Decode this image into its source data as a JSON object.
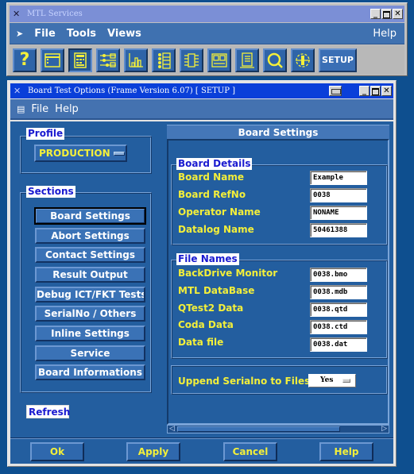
{
  "back_window": {
    "title": "MTL Services",
    "menu": [
      "File",
      "Tools",
      "Views"
    ],
    "help": "Help",
    "toolbar": [
      {
        "icon": "help-question-icon"
      },
      {
        "icon": "window-panel-icon"
      },
      {
        "icon": "calculator-grid-icon",
        "pressed": true
      },
      {
        "icon": "circuit-schematic-icon"
      },
      {
        "icon": "bar-chart-icon"
      },
      {
        "icon": "list-bullets-icon"
      },
      {
        "icon": "ic-chip-icon"
      },
      {
        "icon": "board-layout-icon"
      },
      {
        "icon": "document-list-icon"
      },
      {
        "icon": "magnifier-search-icon"
      },
      {
        "icon": "probe-tool-icon"
      }
    ],
    "setup_label": "SETUP"
  },
  "dialog": {
    "title": "Board Test Options (Frame Version 6.07)  [ SETUP ]",
    "menu_file": "File",
    "menu_help": "Help",
    "profile": {
      "label": "Profile",
      "value": "PRODUCTION"
    },
    "sections": {
      "label": "Sections",
      "items": [
        {
          "label": "Board Settings",
          "active": true
        },
        {
          "label": "Abort Settings"
        },
        {
          "label": "Contact Settings"
        },
        {
          "label": "Result Output"
        },
        {
          "label": "Debug ICT/FKT Tests"
        },
        {
          "label": "SerialNo / Others"
        },
        {
          "label": "Inline Settings"
        },
        {
          "label": "Service"
        },
        {
          "label": "Board Informations"
        }
      ]
    },
    "refresh_label": "Refresh",
    "board_settings": {
      "header": "Board Settings",
      "board_details": {
        "label": "Board Details",
        "fields": [
          {
            "label": "Board Name",
            "value": "Example"
          },
          {
            "label": "Board RefNo",
            "value": "0038"
          },
          {
            "label": "Operator Name",
            "value": "NONAME"
          },
          {
            "label": "Datalog Name",
            "value": "50461388"
          }
        ]
      },
      "file_names": {
        "label": "File Names",
        "fields": [
          {
            "label": "BackDrive Monitor",
            "value": "0038.bmo"
          },
          {
            "label": "MTL DataBase",
            "value": "0038.mdb"
          },
          {
            "label": "QTest2 Data",
            "value": "0038.qtd"
          },
          {
            "label": "Coda Data",
            "value": "0038.ctd"
          },
          {
            "label": "Data file",
            "value": "0038.dat"
          }
        ]
      },
      "uppend": {
        "label": "Uppend Serialno to Files",
        "value": "Yes"
      }
    },
    "buttons": {
      "ok": "Ok",
      "apply": "Apply",
      "cancel": "Cancel",
      "help": "Help"
    }
  }
}
